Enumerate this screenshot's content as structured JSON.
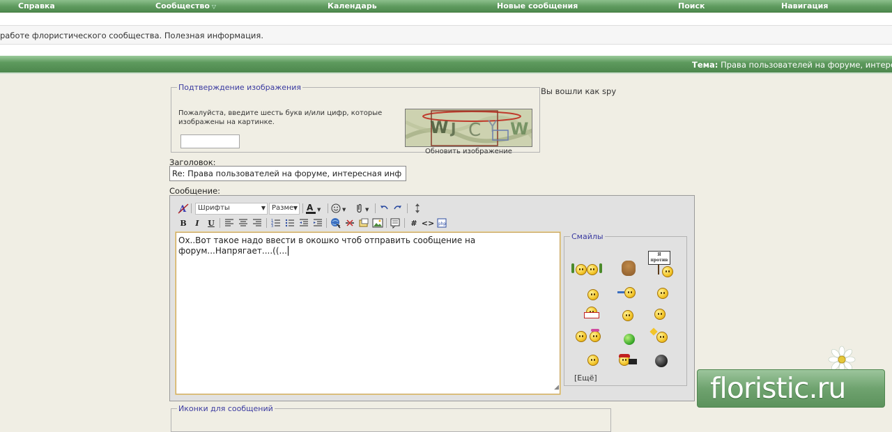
{
  "nav": {
    "items": [
      "Справка",
      "Сообщество",
      "Календарь",
      "Новые сообщения",
      "Поиск",
      "Навигация"
    ]
  },
  "notice": "работе флористического сообщества. Полезная информация.",
  "topic": {
    "label": "Тема:",
    "text": "Права пользователей на форуме, интерес"
  },
  "captcha": {
    "legend": "Подтверждение изображения",
    "hint": "Пожалуйста, введите шесть букв и/или цифр, которые изображены на картинке.",
    "value": "",
    "image_text": "W J C Y W",
    "refresh": "Обновить изображение"
  },
  "logged_in": "Вы вошли как spy",
  "title_field": {
    "label": "Заголовок:",
    "value": "Re: Права пользователей на форуме, интересная инф"
  },
  "message": {
    "label": "Сообщение:",
    "value": "Ох..Вот такое надо ввести в окошко чтоб отправить сообщение на\nфорум...Напрягает....((...",
    "font_select": "Шрифты",
    "size_select": "Разме"
  },
  "smiles": {
    "legend": "Смайлы",
    "more": "[Ещё]",
    "sign_text": "Я против"
  },
  "icons_box": {
    "legend": "Иконки для сообщений"
  },
  "logo": {
    "text": "floristic.ru"
  }
}
